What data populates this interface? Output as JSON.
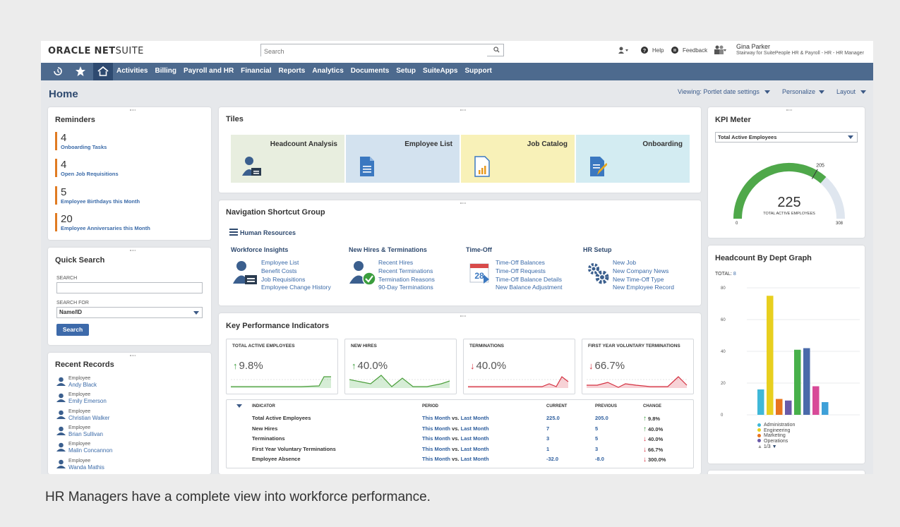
{
  "header": {
    "search_placeholder": "Search",
    "help": "Help",
    "feedback": "Feedback",
    "user_name": "Gina Parker",
    "user_role": "Stairway for SuitePeople HR & Payroll - HR - HR Manager"
  },
  "nav": [
    "Activities",
    "Billing",
    "Payroll and HR",
    "Financial",
    "Reports",
    "Analytics",
    "Documents",
    "Setup",
    "SuiteApps",
    "Support"
  ],
  "page": {
    "title": "Home",
    "viewing": "Viewing: Portlet date settings",
    "personalize": "Personalize",
    "layout": "Layout"
  },
  "reminders": {
    "title": "Reminders",
    "items": [
      {
        "n": "4",
        "label": "Onboarding Tasks"
      },
      {
        "n": "4",
        "label": "Open Job Requisitions"
      },
      {
        "n": "5",
        "label": "Employee Birthdays this Month"
      },
      {
        "n": "20",
        "label": "Employee Anniversaries this Month"
      }
    ]
  },
  "quick_search": {
    "title": "Quick Search",
    "search_label": "SEARCH",
    "search_for_label": "SEARCH FOR",
    "search_for_value": "Name/ID",
    "button": "Search"
  },
  "recent_records": {
    "title": "Recent Records",
    "items": [
      {
        "type": "Employee",
        "name": "Andy Black"
      },
      {
        "type": "Employee",
        "name": "Emily Emerson"
      },
      {
        "type": "Employee",
        "name": "Christian Walker"
      },
      {
        "type": "Employee",
        "name": "Brian Sullivan"
      },
      {
        "type": "Employee",
        "name": "Malin Concannon"
      },
      {
        "type": "Employee",
        "name": "Wanda Mathis"
      }
    ]
  },
  "tiles": {
    "title": "Tiles",
    "items": [
      {
        "label": "Headcount Analysis",
        "color": "#e8eedf"
      },
      {
        "label": "Employee List",
        "color": "#d3e2ef"
      },
      {
        "label": "Job Catalog",
        "color": "#f8f1b8"
      },
      {
        "label": "Onboarding",
        "color": "#d3ecf2"
      }
    ]
  },
  "nav_shortcuts": {
    "title": "Navigation Shortcut Group",
    "group": "Human Resources",
    "columns": [
      {
        "heading": "Workforce Insights",
        "links": [
          "Employee List",
          "Benefit Costs",
          "Job Requisitions",
          "Employee Change History"
        ]
      },
      {
        "heading": "New Hires & Terminations",
        "links": [
          "Recent Hires",
          "Recent Terminations",
          "Termination Reasons",
          "90-Day Terminations"
        ]
      },
      {
        "heading": "Time-Off",
        "links": [
          "Time-Off Balances",
          "Time-Off Requests",
          "Time-Off Balance Details",
          "New Balance Adjustment"
        ]
      },
      {
        "heading": "HR Setup",
        "links": [
          "New Job",
          "New Company News",
          "New Time-Off Type",
          "New Employee Record"
        ]
      }
    ]
  },
  "kpi": {
    "title": "Key Performance Indicators",
    "cards": [
      {
        "label": "TOTAL ACTIVE EMPLOYEES",
        "value": "9.8%",
        "dir": "up"
      },
      {
        "label": "NEW HIRES",
        "value": "40.0%",
        "dir": "up"
      },
      {
        "label": "TERMINATIONS",
        "value": "40.0%",
        "dir": "down"
      },
      {
        "label": "FIRST YEAR VOLUNTARY TERMINATIONS",
        "value": "66.7%",
        "dir": "down"
      }
    ],
    "table_headers": [
      "INDICATOR",
      "PERIOD",
      "CURRENT",
      "PREVIOUS",
      "CHANGE"
    ],
    "rows": [
      {
        "indicator": "Total Active Employees",
        "current": "225.0",
        "previous": "205.0",
        "change": "9.8%",
        "dir": "up"
      },
      {
        "indicator": "New Hires",
        "current": "7",
        "previous": "5",
        "change": "40.0%",
        "dir": "up"
      },
      {
        "indicator": "Terminations",
        "current": "3",
        "previous": "5",
        "change": "40.0%",
        "dir": "down"
      },
      {
        "indicator": "First Year Voluntary Terminations",
        "current": "1",
        "previous": "3",
        "change": "66.7%",
        "dir": "down"
      },
      {
        "indicator": "Employee Absence",
        "current": "-32.0",
        "previous": "-8.0",
        "change": "300.0%",
        "dir": "down"
      }
    ],
    "period_a": "This Month",
    "period_vs": "vs.",
    "period_b": "Last Month"
  },
  "kpi_meter": {
    "title": "KPI Meter",
    "select": "Total Active Employees",
    "value": "225",
    "label": "TOTAL ACTIVE EMPLOYEES",
    "min": "0",
    "max": "308",
    "target": "205"
  },
  "chart_data": {
    "type": "bar",
    "title": "Headcount By Dept Graph",
    "total_label": "TOTAL:",
    "total_value": "8",
    "ylim": [
      0,
      80
    ],
    "yticks": [
      "80",
      "60",
      "40",
      "20",
      "0"
    ],
    "values": [
      16,
      75,
      10,
      9,
      41,
      42,
      18,
      8
    ],
    "colors": [
      "#3fb8d8",
      "#e8cf1e",
      "#e8741e",
      "#6a5aa8",
      "#47b04a",
      "#4a6aaa",
      "#d84a98",
      "#3ea0d8"
    ],
    "legend": [
      {
        "name": "Administration",
        "color": "#3fb8d8"
      },
      {
        "name": "Engineering",
        "color": "#e8cf1e"
      },
      {
        "name": "Marketing",
        "color": "#e8741e"
      },
      {
        "name": "Operations",
        "color": "#6a5aa8"
      }
    ],
    "pager": "1/3"
  },
  "caption": "HR Managers have a complete view into workforce performance."
}
